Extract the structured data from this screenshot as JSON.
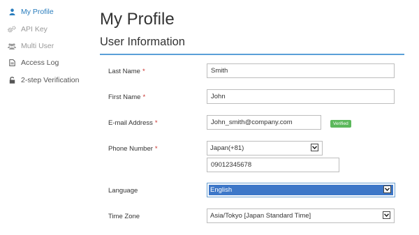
{
  "sidebar": {
    "items": [
      {
        "label": "My Profile",
        "icon": "user-icon",
        "state": "active"
      },
      {
        "label": "API Key",
        "icon": "gears-icon",
        "state": "disabled"
      },
      {
        "label": "Multi User",
        "icon": "users-icon",
        "state": "disabled"
      },
      {
        "label": "Access Log",
        "icon": "document-icon",
        "state": "normal"
      },
      {
        "label": "2-step Verification",
        "icon": "unlock-icon",
        "state": "normal"
      }
    ]
  },
  "page": {
    "title": "My Profile",
    "section_title": "User Information"
  },
  "form": {
    "required_marker": "*",
    "last_name": {
      "label": "Last Name",
      "value": "Smith"
    },
    "first_name": {
      "label": "First Name",
      "value": "John"
    },
    "email": {
      "label": "E-mail Address",
      "value": "John_smith@company.com",
      "badge": "Verified"
    },
    "phone": {
      "label": "Phone Number",
      "country": "Japan(+81)",
      "number": "09012345678"
    },
    "language": {
      "label": "Language",
      "value": "English"
    },
    "timezone": {
      "label": "Time Zone",
      "value": "Asia/Tokyo [Japan Standard Time]"
    }
  },
  "colors": {
    "accent": "#2a7dbd",
    "required": "#c9302c",
    "verified": "#5cb85c",
    "section_rule": "#5aa0d8",
    "selection": "#3d77c8"
  }
}
